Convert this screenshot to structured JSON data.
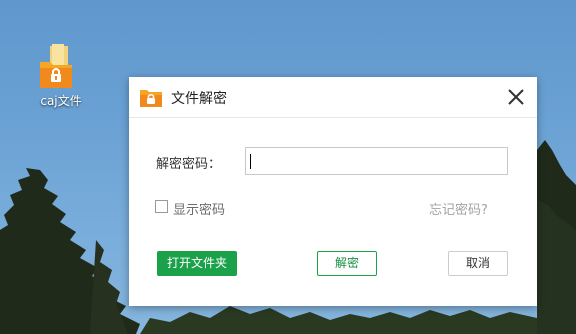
{
  "desktop": {
    "icon_label": "caj文件",
    "icon_name": "locked-folder-icon"
  },
  "dialog": {
    "title": "文件解密",
    "close_icon": "close-icon",
    "password_label": "解密密码：",
    "password_value": "",
    "show_password_label": "显示密码",
    "show_password_checked": false,
    "forgot_password_link": "忘记密码?",
    "open_file_button": "打开文件夹",
    "decrypt_button": "解密",
    "cancel_button": "取消"
  },
  "colors": {
    "accent_green": "#1aa14a",
    "folder_orange": "#f5a623",
    "desktop_sky": "#6aa1d4"
  }
}
